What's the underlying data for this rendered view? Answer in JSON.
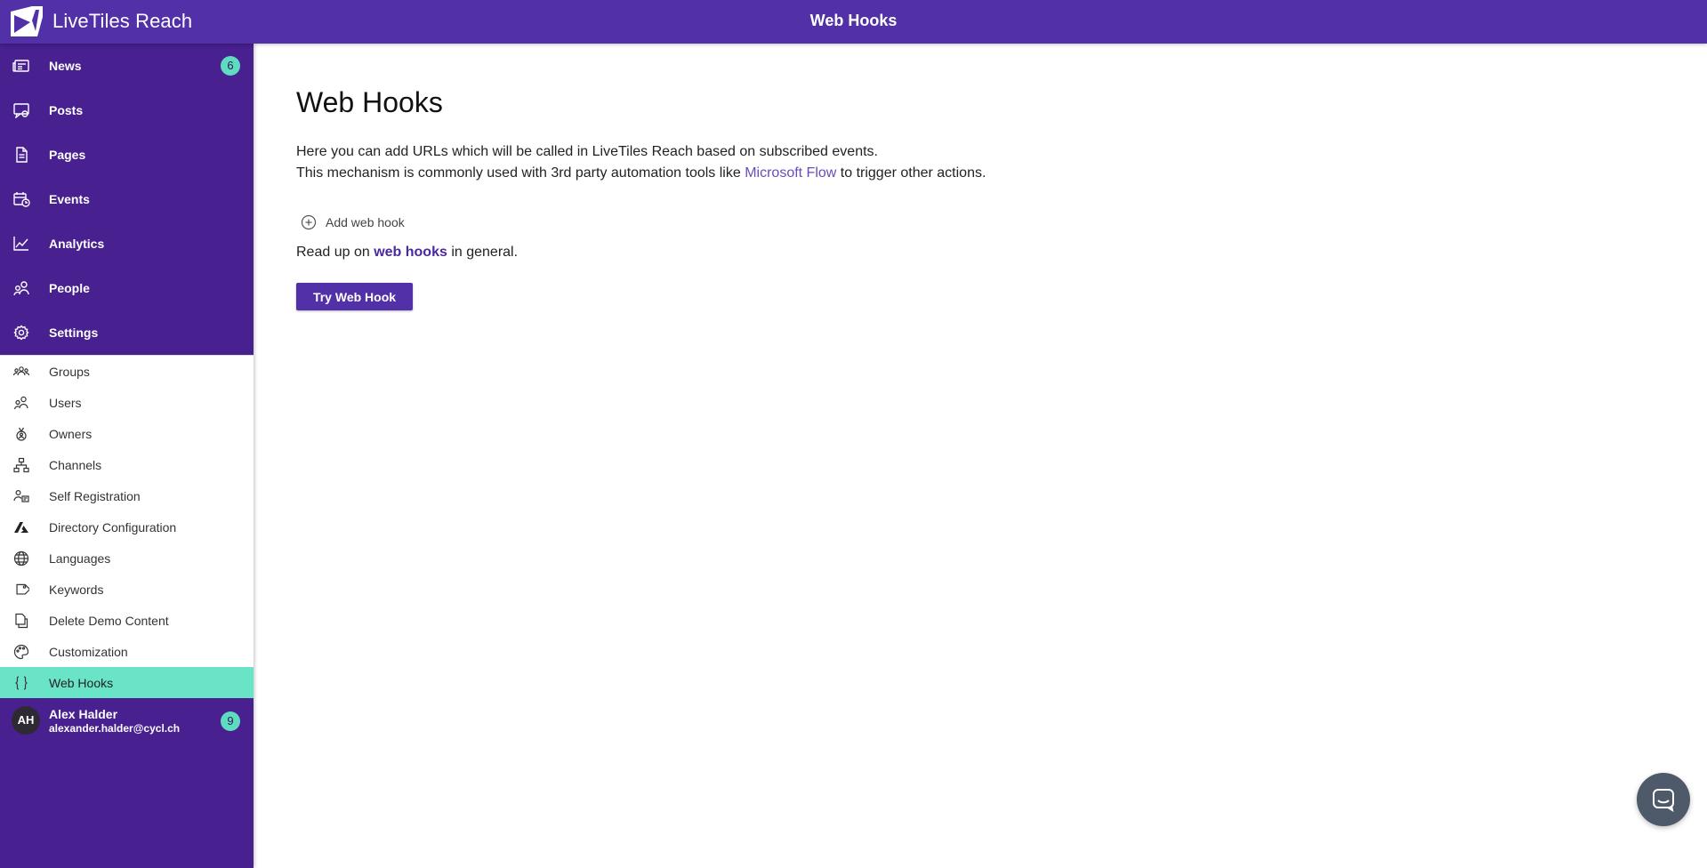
{
  "header": {
    "brand": "LiveTiles Reach",
    "title": "Web Hooks"
  },
  "sidebar": {
    "nav": [
      {
        "id": "news",
        "label": "News",
        "icon": "newspaper-icon",
        "badge": "6"
      },
      {
        "id": "posts",
        "label": "Posts",
        "icon": "post-icon"
      },
      {
        "id": "pages",
        "label": "Pages",
        "icon": "page-icon"
      },
      {
        "id": "events",
        "label": "Events",
        "icon": "calendar-icon"
      },
      {
        "id": "analytics",
        "label": "Analytics",
        "icon": "chart-line-icon"
      },
      {
        "id": "people",
        "label": "People",
        "icon": "people-icon"
      },
      {
        "id": "settings",
        "label": "Settings",
        "icon": "gear-icon"
      }
    ],
    "settings_items": [
      {
        "label": "Groups",
        "icon": "groups-icon"
      },
      {
        "label": "Users",
        "icon": "users-icon"
      },
      {
        "label": "Owners",
        "icon": "owners-icon"
      },
      {
        "label": "Channels",
        "icon": "channels-icon"
      },
      {
        "label": "Self Registration",
        "icon": "self-registration-icon"
      },
      {
        "label": "Directory Configuration",
        "icon": "azure-icon"
      },
      {
        "label": "Languages",
        "icon": "globe-icon"
      },
      {
        "label": "Keywords",
        "icon": "tag-icon"
      },
      {
        "label": "Delete Demo Content",
        "icon": "copy-icon"
      },
      {
        "label": "Customization",
        "icon": "palette-icon"
      },
      {
        "label": "Web Hooks",
        "icon": "braces-icon",
        "active": true
      }
    ],
    "user": {
      "initials": "AH",
      "name": "Alex Halder",
      "email": "alexander.halder@cycl.ch",
      "badge": "9"
    }
  },
  "main": {
    "title": "Web Hooks",
    "description_line1": "Here you can add URLs which will be called in LiveTiles Reach based on subscribed events.",
    "description_line2_pre": "This mechanism is commonly used with 3rd party automation tools like ",
    "description_link": "Microsoft Flow",
    "description_line2_post": " to trigger other actions.",
    "add_label": "Add web hook",
    "readup_pre": "Read up on ",
    "readup_link": "web hooks",
    "readup_post": " in general.",
    "try_button": "Try Web Hook"
  },
  "colors": {
    "primary": "#5130a8",
    "sidebar": "#48208f",
    "accent": "#6ae4c6",
    "badge": "#5fdbc0"
  }
}
